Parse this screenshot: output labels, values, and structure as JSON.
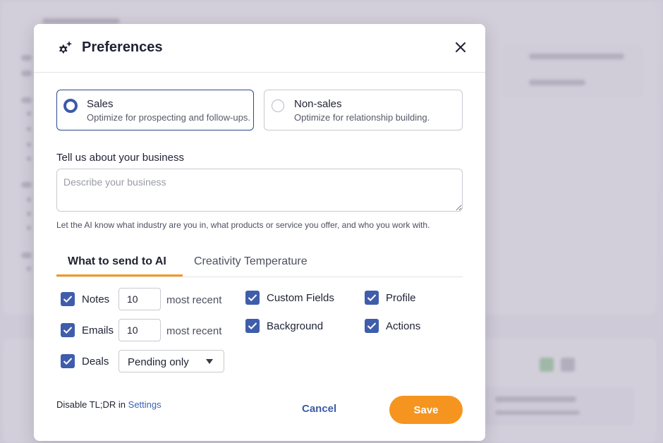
{
  "modal": {
    "title": "Preferences",
    "icon": "gear-sparkle-icon",
    "close_icon": "close-icon"
  },
  "modes": [
    {
      "title": "Sales",
      "description": "Optimize for prospecting and follow-ups.",
      "selected": true
    },
    {
      "title": "Non-sales",
      "description": "Optimize for relationship building.",
      "selected": false
    }
  ],
  "business": {
    "label": "Tell us about your business",
    "placeholder": "Describe your business",
    "value": "",
    "help": "Let the AI know what industry are you in, what products or service you offer, and who you work with."
  },
  "tabs": [
    {
      "label": "What to send to AI",
      "active": true
    },
    {
      "label": "Creativity Temperature",
      "active": false
    }
  ],
  "send_options": {
    "notes": {
      "label": "Notes",
      "checked": true,
      "count": "10",
      "suffix": "most recent"
    },
    "emails": {
      "label": "Emails",
      "checked": true,
      "count": "10",
      "suffix": "most recent"
    },
    "deals": {
      "label": "Deals",
      "checked": true,
      "filter": "Pending only"
    },
    "custom_fields": {
      "label": "Custom Fields",
      "checked": true
    },
    "background": {
      "label": "Background",
      "checked": true
    },
    "profile": {
      "label": "Profile",
      "checked": true
    },
    "actions": {
      "label": "Actions",
      "checked": true
    }
  },
  "footer": {
    "disable_text": "Disable TL;DR in",
    "settings_link": "Settings",
    "cancel": "Cancel",
    "save": "Save"
  },
  "colors": {
    "accent": "#f5951f",
    "primary": "#3d5aa8"
  }
}
